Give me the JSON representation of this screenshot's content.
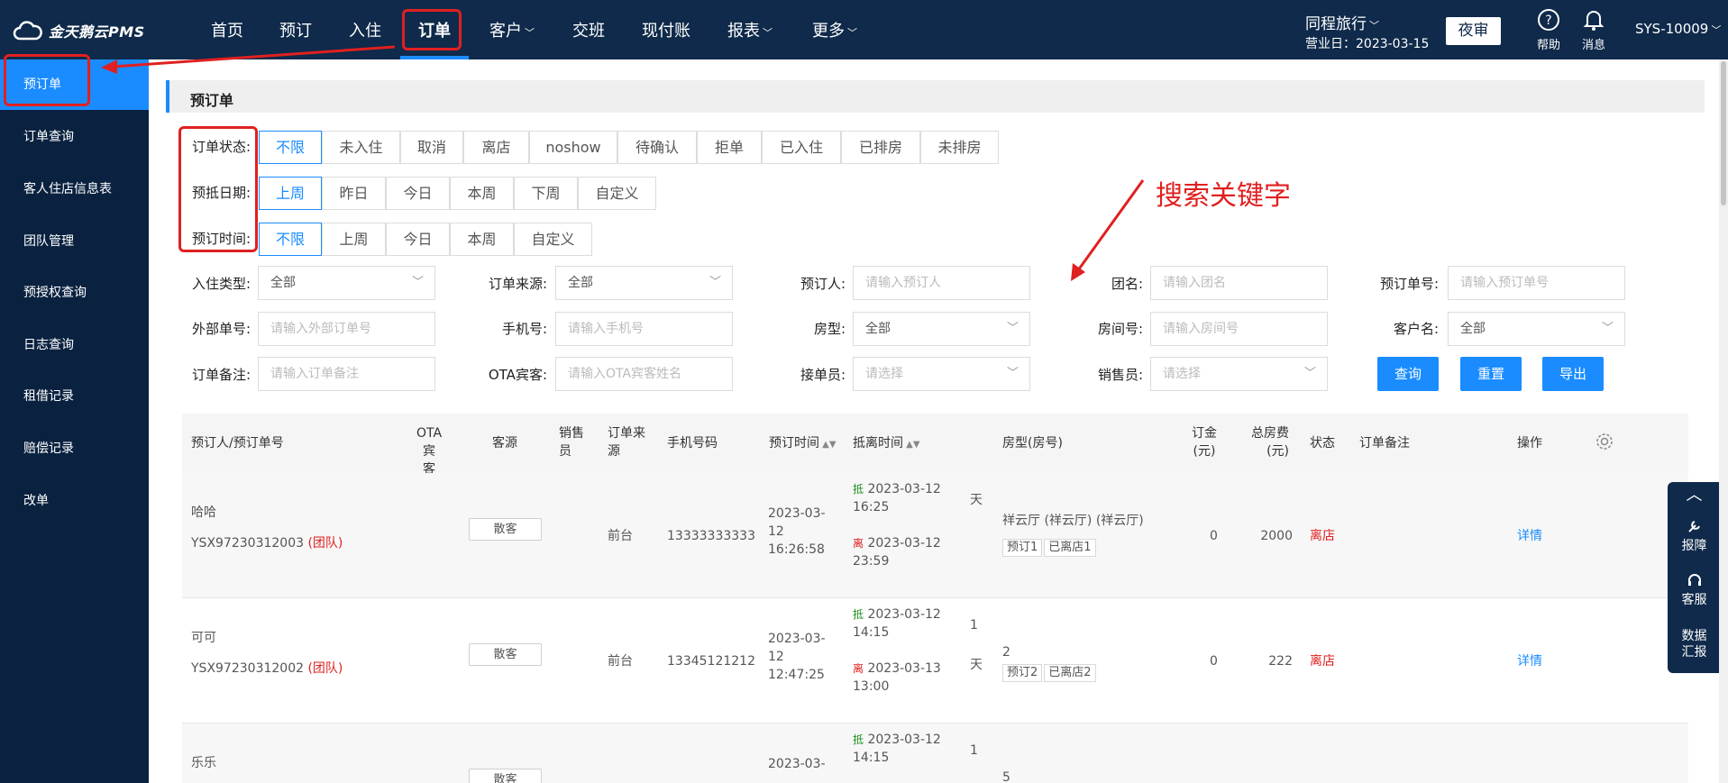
{
  "header": {
    "logo_text": "金天鹅云PMS",
    "nav": [
      {
        "label": "首页",
        "dropdown": false
      },
      {
        "label": "预订",
        "dropdown": false
      },
      {
        "label": "入住",
        "dropdown": false
      },
      {
        "label": "订单",
        "dropdown": false,
        "active": true
      },
      {
        "label": "客户",
        "dropdown": true
      },
      {
        "label": "交班",
        "dropdown": false
      },
      {
        "label": "现付账",
        "dropdown": false
      },
      {
        "label": "报表",
        "dropdown": true
      },
      {
        "label": "更多",
        "dropdown": true
      }
    ],
    "hotel_name": "同程旅行",
    "business_date": "营业日：2023-03-15",
    "night_audit_label": "夜审",
    "help_label": "帮助",
    "message_label": "消息",
    "user": "SYS-10009"
  },
  "sidebar": {
    "items": [
      {
        "label": "预订单",
        "active": true
      },
      {
        "label": "订单查询"
      },
      {
        "label": "客人住店信息表"
      },
      {
        "label": "团队管理"
      },
      {
        "label": "预授权查询"
      },
      {
        "label": "日志查询"
      },
      {
        "label": "租借记录"
      },
      {
        "label": "赔偿记录"
      },
      {
        "label": "改单"
      }
    ]
  },
  "page": {
    "title": "预订单",
    "annotation": "搜索关键字"
  },
  "filters": {
    "order_status": {
      "label": "订单状态:",
      "options": [
        "不限",
        "未入住",
        "取消",
        "离店",
        "noshow",
        "待确认",
        "拒单",
        "已入住",
        "已排房",
        "未排房"
      ],
      "selected": "不限"
    },
    "arrival_date": {
      "label": "预抵日期:",
      "options": [
        "上周",
        "昨日",
        "今日",
        "本周",
        "下周",
        "自定义"
      ],
      "selected": "上周"
    },
    "booking_time": {
      "label": "预订时间:",
      "options": [
        "不限",
        "上周",
        "今日",
        "本周",
        "自定义"
      ],
      "selected": "不限"
    }
  },
  "form": {
    "checkin_type": {
      "label": "入住类型:",
      "value": "全部"
    },
    "order_source": {
      "label": "订单来源:",
      "value": "全部"
    },
    "booker": {
      "label": "预订人:",
      "placeholder": "请输入预订人"
    },
    "group_name": {
      "label": "团名:",
      "placeholder": "请输入团名"
    },
    "booking_no": {
      "label": "预订单号:",
      "placeholder": "请输入预订单号"
    },
    "external_no": {
      "label": "外部单号:",
      "placeholder": "请输入外部订单号"
    },
    "phone": {
      "label": "手机号:",
      "placeholder": "请输入手机号"
    },
    "room_type": {
      "label": "房型:",
      "value": "全部"
    },
    "room_no": {
      "label": "房间号:",
      "placeholder": "请输入房间号"
    },
    "customer_name": {
      "label": "客户名:",
      "value": "全部"
    },
    "order_remark": {
      "label": "订单备注:",
      "placeholder": "请输入订单备注"
    },
    "ota_guest": {
      "label": "OTA宾客:",
      "placeholder": "请输入OTA宾客姓名"
    },
    "receptionist": {
      "label": "接单员:",
      "placeholder": "请选择"
    },
    "salesperson": {
      "label": "销售员:",
      "placeholder": "请选择"
    },
    "search_btn": "查询",
    "reset_btn": "重置",
    "export_btn": "导出"
  },
  "table": {
    "headers": {
      "booker": "预订人/预订单号",
      "ota_guest_1": "OTA宾",
      "ota_guest_2": "客",
      "source": "客源",
      "sales_1": "销售",
      "sales_2": "员",
      "order_source_1": "订单来",
      "order_source_2": "源",
      "phone": "手机号码",
      "booking_time": "预订时间",
      "arr_dep": "抵离时间",
      "room": "房型(房号)",
      "deposit_1": "订金",
      "deposit_2": "(元)",
      "total_1": "总房费",
      "total_2": "(元)",
      "status": "状态",
      "remark": "订单备注",
      "ops": "操作"
    },
    "rows": [
      {
        "name": "哈哈",
        "order_no": "YSX97230312003",
        "group": "(团队)",
        "source": "散客",
        "order_source": "前台",
        "phone": "13333333333",
        "booking_time_1": "2023-03-",
        "booking_time_2": "12",
        "booking_time_3": "16:26:58",
        "arr_label": "抵",
        "arr_date": "2023-03-12",
        "arr_time": "16:25",
        "dep_label": "离",
        "dep_date": "2023-03-12",
        "dep_time": "23:59",
        "nights_1": "",
        "nights_2": "天",
        "room_name": "祥云厅 (祥云厅) (祥云厅)",
        "tag1": "预订1",
        "tag2": "已离店1",
        "deposit": "0",
        "total": "2000",
        "status": "离店",
        "action": "详情"
      },
      {
        "name": "可可",
        "order_no": "YSX97230312002",
        "group": "(团队)",
        "source": "散客",
        "order_source": "前台",
        "phone": "13345121212",
        "booking_time_1": "2023-03-",
        "booking_time_2": "12",
        "booking_time_3": "12:47:25",
        "arr_label": "抵",
        "arr_date": "2023-03-12",
        "arr_time": "14:15",
        "dep_label": "离",
        "dep_date": "2023-03-13",
        "dep_time": "13:00",
        "nights_1": "1",
        "nights_2": "天",
        "room_name": "2",
        "tag1": "预订2",
        "tag2": "已离店2",
        "deposit": "0",
        "total": "222",
        "status": "离店",
        "action": "详情"
      },
      {
        "name": "乐乐",
        "source": "散客",
        "booking_time_1": "2023-03-",
        "arr_label": "抵",
        "arr_date": "2023-03-12",
        "arr_time": "14:15",
        "nights_1": "1",
        "room_name": "5"
      }
    ]
  },
  "float_panel": {
    "report_label": "报障",
    "service_label": "客服",
    "data_label_1": "数据",
    "data_label_2": "汇报"
  }
}
